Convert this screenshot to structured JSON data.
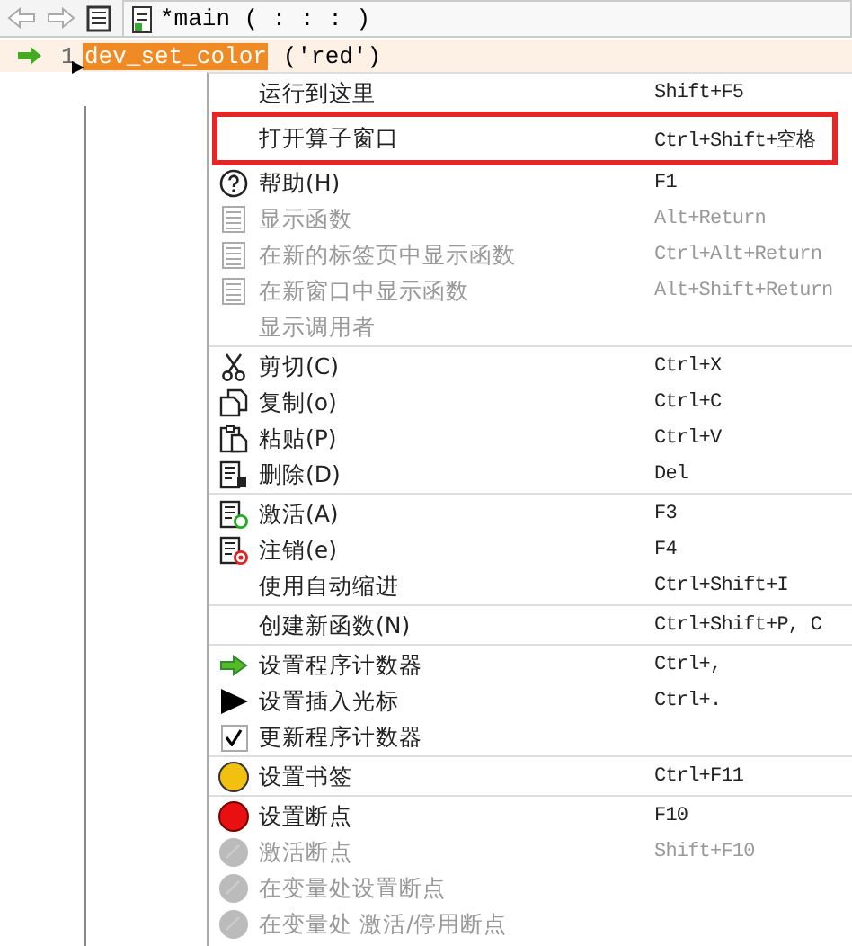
{
  "toolbar": {
    "tab": {
      "title": "*main ( : : : )",
      "selected": true
    }
  },
  "editor": {
    "lines": [
      {
        "number": "1",
        "token": "dev_set_color",
        "rest": "('red')",
        "current": true,
        "cursor": true
      }
    ]
  },
  "context_menu": {
    "groups": [
      [
        {
          "kind": "none",
          "label": "运行到这里",
          "shortcut": "Shift+F5",
          "disabled": false,
          "highlighted": false
        },
        {
          "kind": "none",
          "label": "打开算子窗口",
          "shortcut": "Ctrl+Shift+空格",
          "disabled": false,
          "highlighted": true
        },
        {
          "kind": "help",
          "label": "帮助(H)",
          "shortcut": "F1",
          "disabled": false,
          "highlighted": false
        },
        {
          "kind": "doc",
          "label": "显示函数",
          "shortcut": "Alt+Return",
          "disabled": true,
          "highlighted": false
        },
        {
          "kind": "doc",
          "label": "在新的标签页中显示函数",
          "shortcut": "Ctrl+Alt+Return",
          "disabled": true,
          "highlighted": false
        },
        {
          "kind": "doc",
          "label": "在新窗口中显示函数",
          "shortcut": "Alt+Shift+Return",
          "disabled": true,
          "highlighted": false
        },
        {
          "kind": "none",
          "label": "显示调用者",
          "disabled": true,
          "highlighted": false
        }
      ],
      [
        {
          "kind": "cut",
          "label": "剪切(C)",
          "shortcut": "Ctrl+X",
          "disabled": false,
          "highlighted": false
        },
        {
          "kind": "copy",
          "label": "复制(o)",
          "shortcut": "Ctrl+C",
          "disabled": false,
          "highlighted": false
        },
        {
          "kind": "paste",
          "label": "粘贴(P)",
          "shortcut": "Ctrl+V",
          "disabled": false,
          "highlighted": false
        },
        {
          "kind": "delete",
          "label": "删除(D)",
          "shortcut": "Del",
          "disabled": false,
          "highlighted": false
        }
      ],
      [
        {
          "kind": "activate",
          "label": "激活(A)",
          "shortcut": "F3",
          "disabled": false,
          "highlighted": false
        },
        {
          "kind": "deactivate",
          "label": "注销(e)",
          "shortcut": "F4",
          "disabled": false,
          "highlighted": false
        },
        {
          "kind": "none",
          "label": "使用自动缩进",
          "shortcut": "Ctrl+Shift+I",
          "disabled": false,
          "highlighted": false
        }
      ],
      [
        {
          "kind": "none",
          "label": "创建新函数(N)",
          "shortcut": "Ctrl+Shift+P, C",
          "disabled": false,
          "highlighted": false
        }
      ],
      [
        {
          "kind": "pc",
          "label": "设置程序计数器",
          "shortcut": "Ctrl+,",
          "disabled": false,
          "highlighted": false
        },
        {
          "kind": "cursor",
          "label": "设置插入光标",
          "shortcut": "Ctrl+.",
          "disabled": false,
          "highlighted": false
        },
        {
          "kind": "check",
          "label": "更新程序计数器",
          "checked": true,
          "disabled": false,
          "highlighted": false
        }
      ],
      [
        {
          "kind": "bookmark",
          "label": "设置书签",
          "shortcut": "Ctrl+F11",
          "disabled": false,
          "highlighted": false
        }
      ],
      [
        {
          "kind": "breakpoint",
          "label": "设置断点",
          "shortcut": "F10",
          "disabled": false,
          "highlighted": false
        },
        {
          "kind": "breakpoint",
          "label": "激活断点",
          "shortcut": "Shift+F10",
          "disabled": true,
          "highlighted": false
        },
        {
          "kind": "breakpoint",
          "label": "在变量处设置断点",
          "disabled": true,
          "highlighted": false
        },
        {
          "kind": "breakpoint",
          "label": "在变量处 激活/停用断点",
          "disabled": true,
          "highlighted": false
        }
      ]
    ]
  }
}
